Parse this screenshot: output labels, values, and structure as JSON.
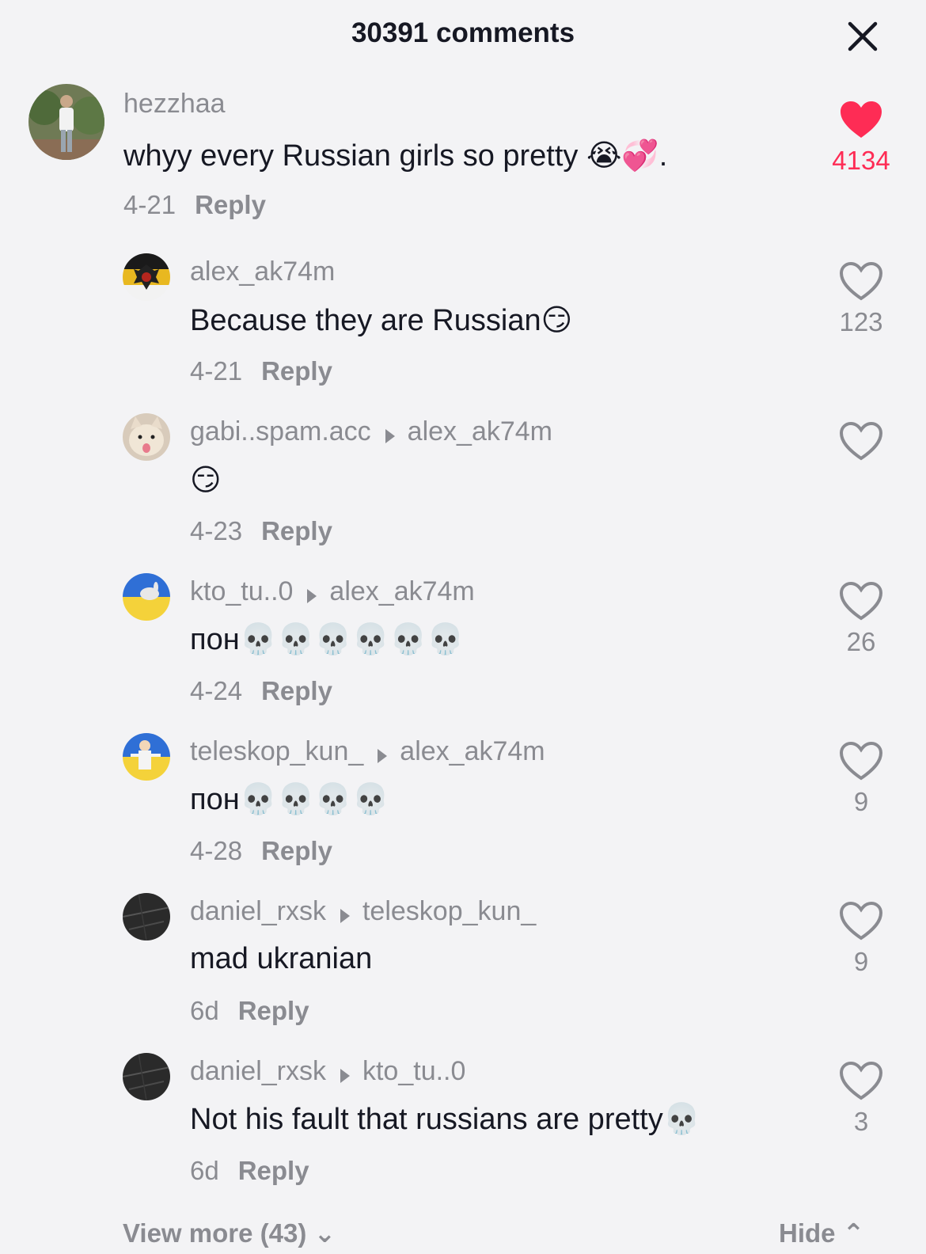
{
  "header": {
    "title": "30391 comments"
  },
  "comments": [
    {
      "username": "hezzhaa",
      "text": "whyy every Russian girls so pretty 😭💞.",
      "date": "4-21",
      "reply_label": "Reply",
      "likes": "4134",
      "liked": true
    },
    {
      "username": "alex_ak74m",
      "reply_to": "",
      "text": "Because they are Russian😏",
      "date": "4-21",
      "reply_label": "Reply",
      "likes": "123"
    },
    {
      "username": "gabi..spam.acc",
      "reply_to": "alex_ak74m",
      "text": "😏",
      "date": "4-23",
      "reply_label": "Reply",
      "likes": ""
    },
    {
      "username": "kto_tu..0",
      "reply_to": "alex_ak74m",
      "text": "пон💀💀💀💀💀💀",
      "date": "4-24",
      "reply_label": "Reply",
      "likes": "26"
    },
    {
      "username": "teleskop_kun_",
      "reply_to": "alex_ak74m",
      "text": "пон💀💀💀💀",
      "date": "4-28",
      "reply_label": "Reply",
      "likes": "9"
    },
    {
      "username": "daniel_rxsk",
      "reply_to": "teleskop_kun_",
      "text": "mad ukranian",
      "date": "6d",
      "reply_label": "Reply",
      "likes": "9"
    },
    {
      "username": "daniel_rxsk",
      "reply_to": "kto_tu..0",
      "text": "Not his fault that russians are pretty💀",
      "date": "6d",
      "reply_label": "Reply",
      "likes": "3"
    }
  ],
  "footer": {
    "view_more": "View more (43) ⌄",
    "hide": "Hide ⌃"
  },
  "colors": {
    "like_active": "#fe2c55",
    "muted": "#8a8b91",
    "background": "#f3f3f5"
  },
  "icons": {
    "close": "close-icon",
    "heart_filled": "heart-filled-icon",
    "heart_outline": "heart-outline-icon",
    "reply_arrow": "reply-arrow-icon"
  }
}
